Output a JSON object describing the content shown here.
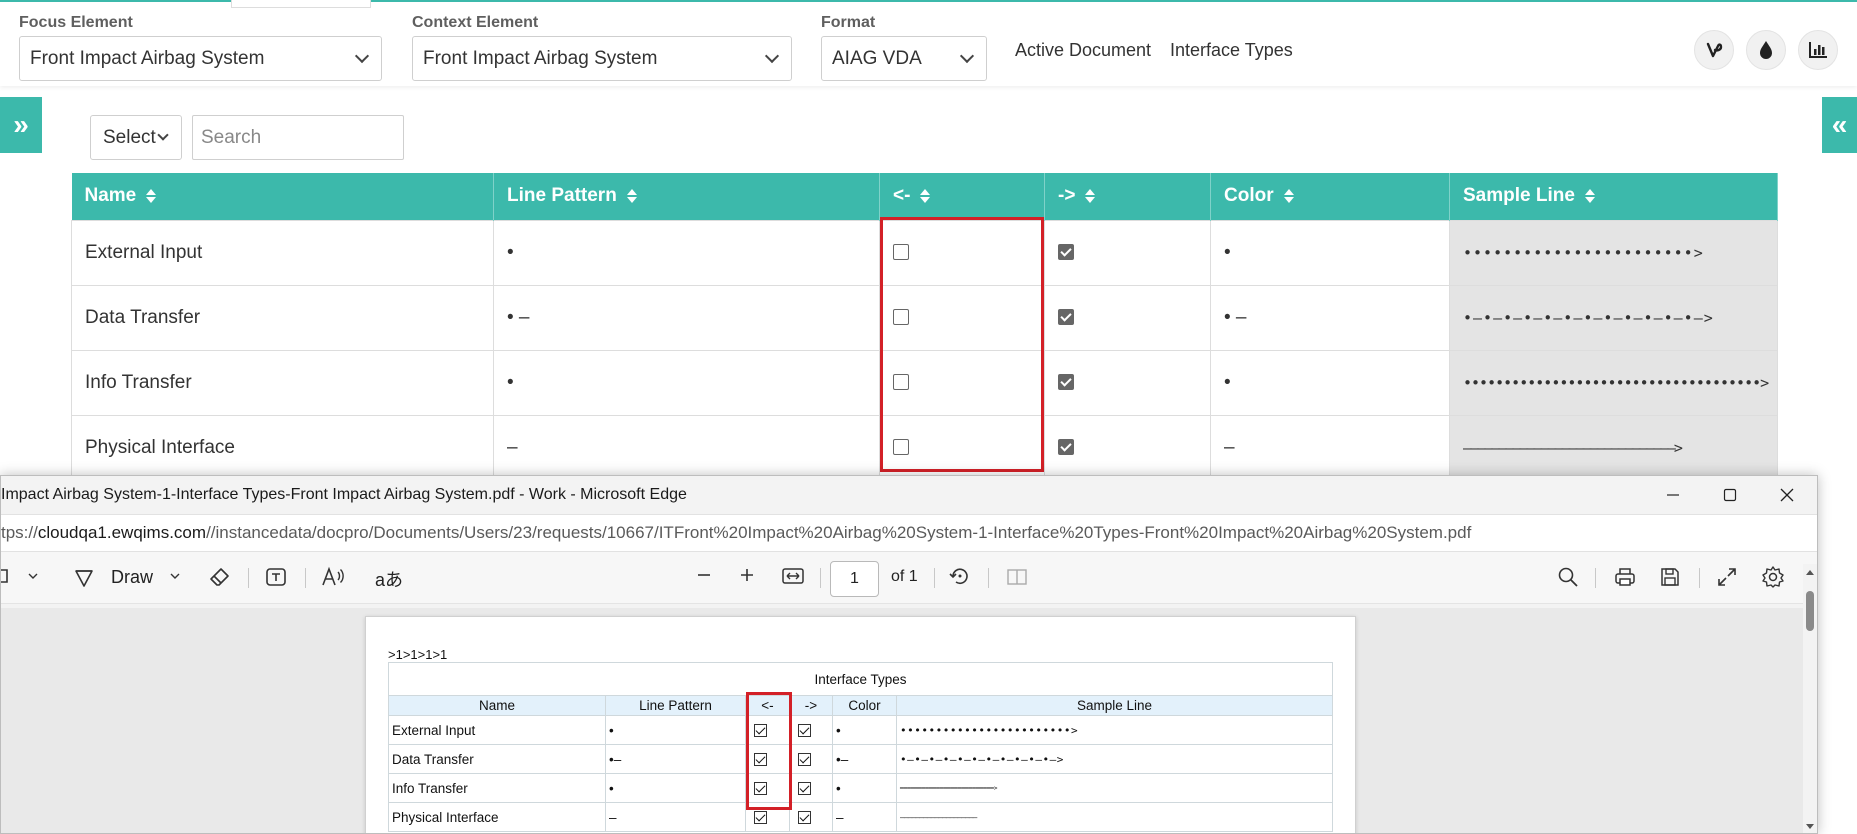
{
  "toolbar": {
    "focus_label": "Focus Element",
    "focus_value": "Front Impact Airbag System",
    "context_label": "Context Element",
    "context_value": "Front Impact Airbag System",
    "format_label": "Format",
    "format_value": "AIAG VDA",
    "active_document": "Active Document",
    "interface_types": "Interface Types"
  },
  "filter": {
    "select_value": "Select",
    "search_placeholder": "Search"
  },
  "table": {
    "headers": [
      "Name",
      "Line Pattern",
      "<-",
      "->",
      "Color",
      "Sample Line"
    ],
    "rows": [
      {
        "name": "External Input",
        "pattern": "•",
        "in": false,
        "out": true,
        "color": "•",
        "sample": "•••••••••••••••••••••••>"
      },
      {
        "name": "Data Transfer",
        "pattern": "• –",
        "in": false,
        "out": true,
        "color": "• –",
        "sample": "•–•–•–•–•–•–•–•–•–•–•–•–>"
      },
      {
        "name": "Info Transfer",
        "pattern": "•",
        "in": false,
        "out": true,
        "color": "•",
        "sample": "•••••••••••••••••••••••••••••••••••••>"
      },
      {
        "name": "Physical Interface",
        "pattern": "–",
        "in": false,
        "out": true,
        "color": "–",
        "sample": "––––––––––––––––––––––––––––––>"
      }
    ]
  },
  "edge": {
    "title": "Impact Airbag System-1-Interface Types-Front Impact Airbag System.pdf - Work - Microsoft Edge",
    "url_prefix": "tps://",
    "url_host": "cloudqa1.ewqims.com",
    "url_path": "//instancedata/docpro/Documents/Users/23/requests/10667/ITFront%20Impact%20Airbag%20System-1-Interface%20Types-Front%20Impact%20Airbag%20System.pdf",
    "draw_label": "Draw",
    "page_number": "1",
    "page_total": "of 1"
  },
  "pdf": {
    "breadcrumb": ">1>1>1>1",
    "caption": "Interface Types",
    "headers": [
      "Name",
      "Line Pattern",
      "<-",
      "->",
      "Color",
      "Sample Line"
    ],
    "rows": [
      {
        "name": "External Input",
        "pattern": "•",
        "color": "•",
        "sample": "••••••••••••••••••••••••>"
      },
      {
        "name": "Data Transfer",
        "pattern": "•–",
        "color": "•–",
        "sample": "•–•–•–•–•–•–•–•–•–•–•–>"
      },
      {
        "name": "Info Transfer",
        "pattern": "•",
        "color": "•",
        "sample": "━━━━━━━━━━━━━━━━━━━━━━━━━━>"
      },
      {
        "name": "Physical Interface",
        "pattern": "–",
        "color": "–",
        "sample": "————————————————————"
      }
    ]
  },
  "colors": {
    "accent": "#3cb9ab",
    "highlight_box": "#d32027"
  }
}
